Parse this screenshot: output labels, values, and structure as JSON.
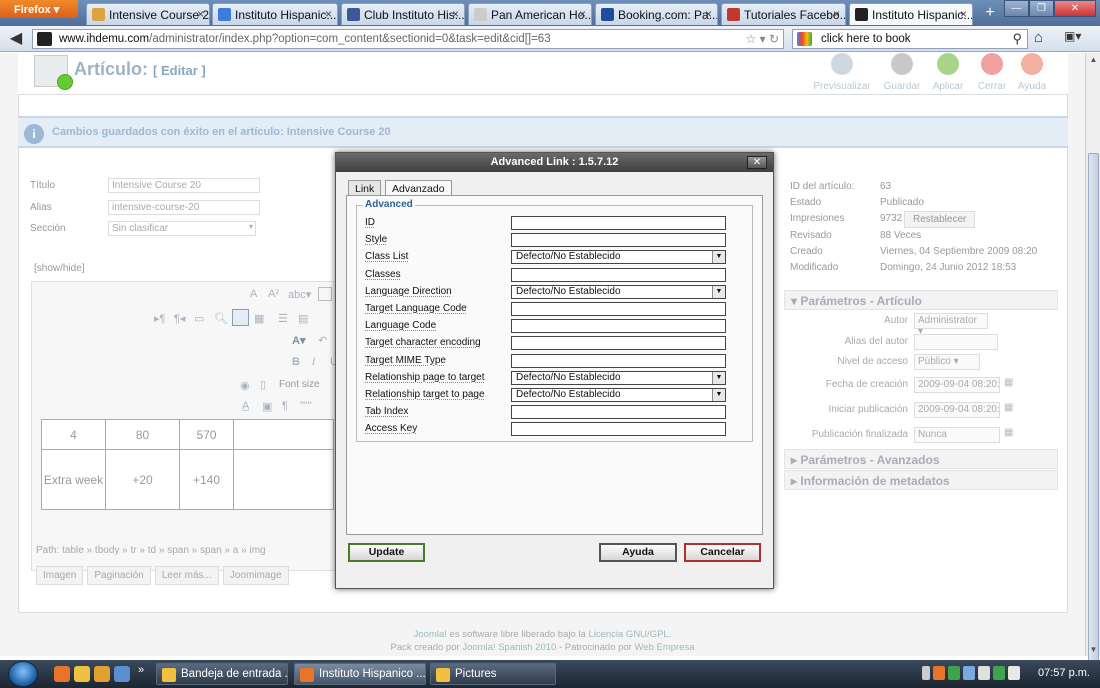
{
  "browser": {
    "menu_label": "Firefox",
    "tabs": [
      {
        "label": "Intensive Course 20",
        "color": "#d9a441"
      },
      {
        "label": "Instituto Hispanic...",
        "color": "#3b7dd8"
      },
      {
        "label": "Club Instituto His...",
        "color": "#3b5998"
      },
      {
        "label": "Pan American Ho...",
        "color": "#cccccc"
      },
      {
        "label": "Booking.com: Pa...",
        "color": "#1f4d99"
      },
      {
        "label": "Tutoriales Facebo...",
        "color": "#c0392b"
      },
      {
        "label": "Instituto Hispanic...",
        "color": "#222222"
      }
    ],
    "tab_close": "×",
    "new_tab": "+",
    "url_domain": "www.ihdemu.com",
    "url_path": "/administrator/index.php?option=com_content&sectionid=0&task=edit&cid[]=63",
    "search_text": "click here to book"
  },
  "header": {
    "title": "Artículo:",
    "edit_label": "[ Editar ]",
    "toolbar": [
      {
        "label": "Previsualizar",
        "color": "#cfd8e0"
      },
      {
        "label": "Guardar",
        "color": "#c8c8c8"
      },
      {
        "label": "Aplicar",
        "color": "#a8d48a"
      },
      {
        "label": "Cerrar",
        "color": "#f0a0a0"
      },
      {
        "label": "Ayuda",
        "color": "#f5b0a0"
      }
    ]
  },
  "message": {
    "text": "Cambios guardados con éxito en el artículo: Intensive Course 20"
  },
  "form": {
    "title_label": "Título",
    "title_value": "Intensive Course 20",
    "alias_label": "Alias",
    "alias_value": "intensive-course-20",
    "section_label": "Sección",
    "section_value": "Sin clasificar",
    "showhide": "[show/hide]"
  },
  "editor": {
    "font_size_label": "Font size",
    "table_rows": [
      {
        "c1": "4",
        "c2": "80",
        "c3": "570"
      },
      {
        "c1": "Extra week",
        "c2": "+20",
        "c3": "+140"
      }
    ],
    "path": "Path: table » tbody » tr » td » span » span » a » img",
    "buttons": [
      "Imagen",
      "Paginación",
      "Leer más...",
      "Joomimage"
    ]
  },
  "info": {
    "id_label": "ID del artículo:",
    "id_value": "63",
    "state_label": "Estado",
    "state_value": "Publicado",
    "hits_label": "Impresiones",
    "hits_value": "9732",
    "reset_label": "Restablecer",
    "revised_label": "Revisado",
    "revised_value": "88 Veces",
    "created_label": "Creado",
    "created_value": "Viernes, 04 Septiembre 2009 08:20",
    "modified_label": "Modificado",
    "modified_value": "Domingo, 24 Junio 2012 18:53"
  },
  "params": {
    "section_title": "Parámetros - Artículo",
    "author_label": "Autor",
    "author_value": "Administrator",
    "alias_author_label": "Alias del autor",
    "access_label": "Nivel de acceso",
    "access_value": "Público",
    "created_date_label": "Fecha de creación",
    "created_date_value": "2009-09-04 08:20:46",
    "start_pub_label": "Iniciar publicación",
    "start_pub_value": "2009-09-04 08:20:46",
    "end_pub_label": "Publicación finalizada",
    "end_pub_value": "Nunca",
    "advanced_title": "Parámetros - Avanzados",
    "meta_title": "Información de metadatos"
  },
  "footer": {
    "line1_a": "Joomla!",
    "line1_b": " es software libre liberado bajo la ",
    "line1_c": "Licencia GNU/GPL.",
    "line2_a": "Pack creado por ",
    "line2_b": "Joomla! Spanish 2010",
    "line2_c": " - Patrocinado por ",
    "line2_d": "Web Empresa"
  },
  "modal": {
    "title": "Advanced Link : 1.5.7.12",
    "close": "✕",
    "tab_link": "Link",
    "tab_advanced": "Advanzado",
    "legend": "Advanced",
    "fields": [
      {
        "label": "ID",
        "type": "text",
        "value": ""
      },
      {
        "label": "Style",
        "type": "text",
        "value": ""
      },
      {
        "label": "Class List",
        "type": "select",
        "value": "Defecto/No Establecido"
      },
      {
        "label": "Classes",
        "type": "text",
        "value": ""
      },
      {
        "label": "Language Direction",
        "type": "select",
        "value": "Defecto/No Establecido"
      },
      {
        "label": "Target Language Code",
        "type": "text",
        "value": ""
      },
      {
        "label": "Language Code",
        "type": "text",
        "value": ""
      },
      {
        "label": "Target character encoding",
        "type": "text",
        "value": ""
      },
      {
        "label": "Target MIME Type",
        "type": "text",
        "value": ""
      },
      {
        "label": "Relationship page to target",
        "type": "select",
        "value": "Defecto/No Establecido"
      },
      {
        "label": "Relationship target to page",
        "type": "select",
        "value": "Defecto/No Establecido"
      },
      {
        "label": "Tab Index",
        "type": "text",
        "value": ""
      },
      {
        "label": "Access Key",
        "type": "text",
        "value": ""
      }
    ],
    "update_label": "Update",
    "help_label": "Ayuda",
    "cancel_label": "Cancelar"
  },
  "taskbar": {
    "tasks": [
      {
        "label": "Bandeja de entrada ...",
        "color": "#f0c040"
      },
      {
        "label": "Instituto Hispanico ...",
        "color": "#e8742a"
      },
      {
        "label": "Pictures",
        "color": "#f0c040"
      }
    ],
    "clock": "07:57 p.m."
  }
}
